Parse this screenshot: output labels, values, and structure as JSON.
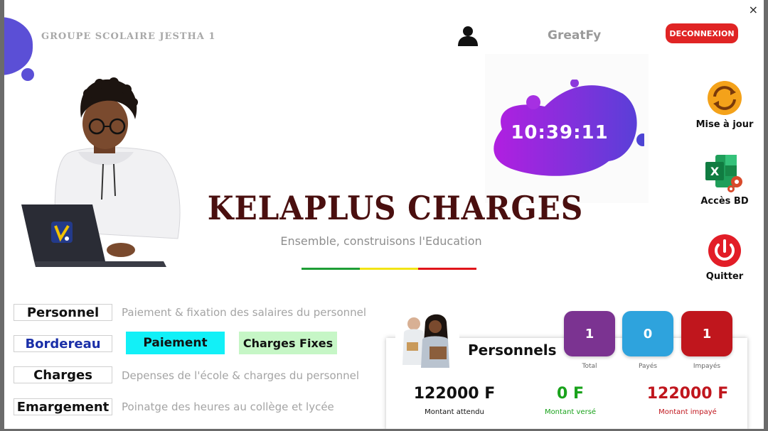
{
  "header": {
    "school_name": "GROUPE SCOLAIRE JESTHA 1",
    "username": "GreatFy",
    "logout_label": "DECONNEXION",
    "close_symbol": "×"
  },
  "clock": {
    "time": "10:39:11"
  },
  "app": {
    "title": "KELAPLUS  CHARGES",
    "tagline": "Ensemble, construisons l'Education"
  },
  "side_actions": [
    {
      "label": "Mise à jour",
      "icon": "refresh-icon"
    },
    {
      "label": "Accès BD",
      "icon": "excel-icon"
    },
    {
      "label": "Quitter",
      "icon": "power-icon"
    }
  ],
  "menu": {
    "personnel": {
      "label": "Personnel",
      "desc": "Paiement & fixation des salaires du personnel"
    },
    "bordereau": {
      "label": "Bordereau"
    },
    "paiement": {
      "label": "Paiement"
    },
    "charges_fixes": {
      "label": "Charges Fixes"
    },
    "charges": {
      "label": "Charges",
      "desc": "Depenses de l'école & charges du personnel"
    },
    "emargement": {
      "label": "Emargement",
      "desc": "Poinatge des heures au collège et lycée"
    }
  },
  "personnels_card": {
    "title": "Personnels",
    "stats": [
      {
        "value": "1",
        "label": "Total",
        "color": "#7b3391"
      },
      {
        "value": "0",
        "label": "Payés",
        "color": "#2ea3dd"
      },
      {
        "value": "1",
        "label": "Impayés",
        "color": "#c0161d"
      }
    ],
    "amounts": [
      {
        "value": "122000 F",
        "label": "Montant attendu",
        "color": "#111111"
      },
      {
        "value": "0 F",
        "label": "Montant versé",
        "color": "#19a21b"
      },
      {
        "value": "122000 F",
        "label": "Montant impayé",
        "color": "#c0161d"
      }
    ]
  },
  "colors": {
    "accent_purple": "#5b4fd6",
    "logout_red": "#e02424",
    "paiement_bg": "#12f0f7",
    "charges_fixes_bg": "#c6f6c6",
    "flag": [
      "#1e9e35",
      "#f2e415",
      "#e0151a"
    ]
  }
}
